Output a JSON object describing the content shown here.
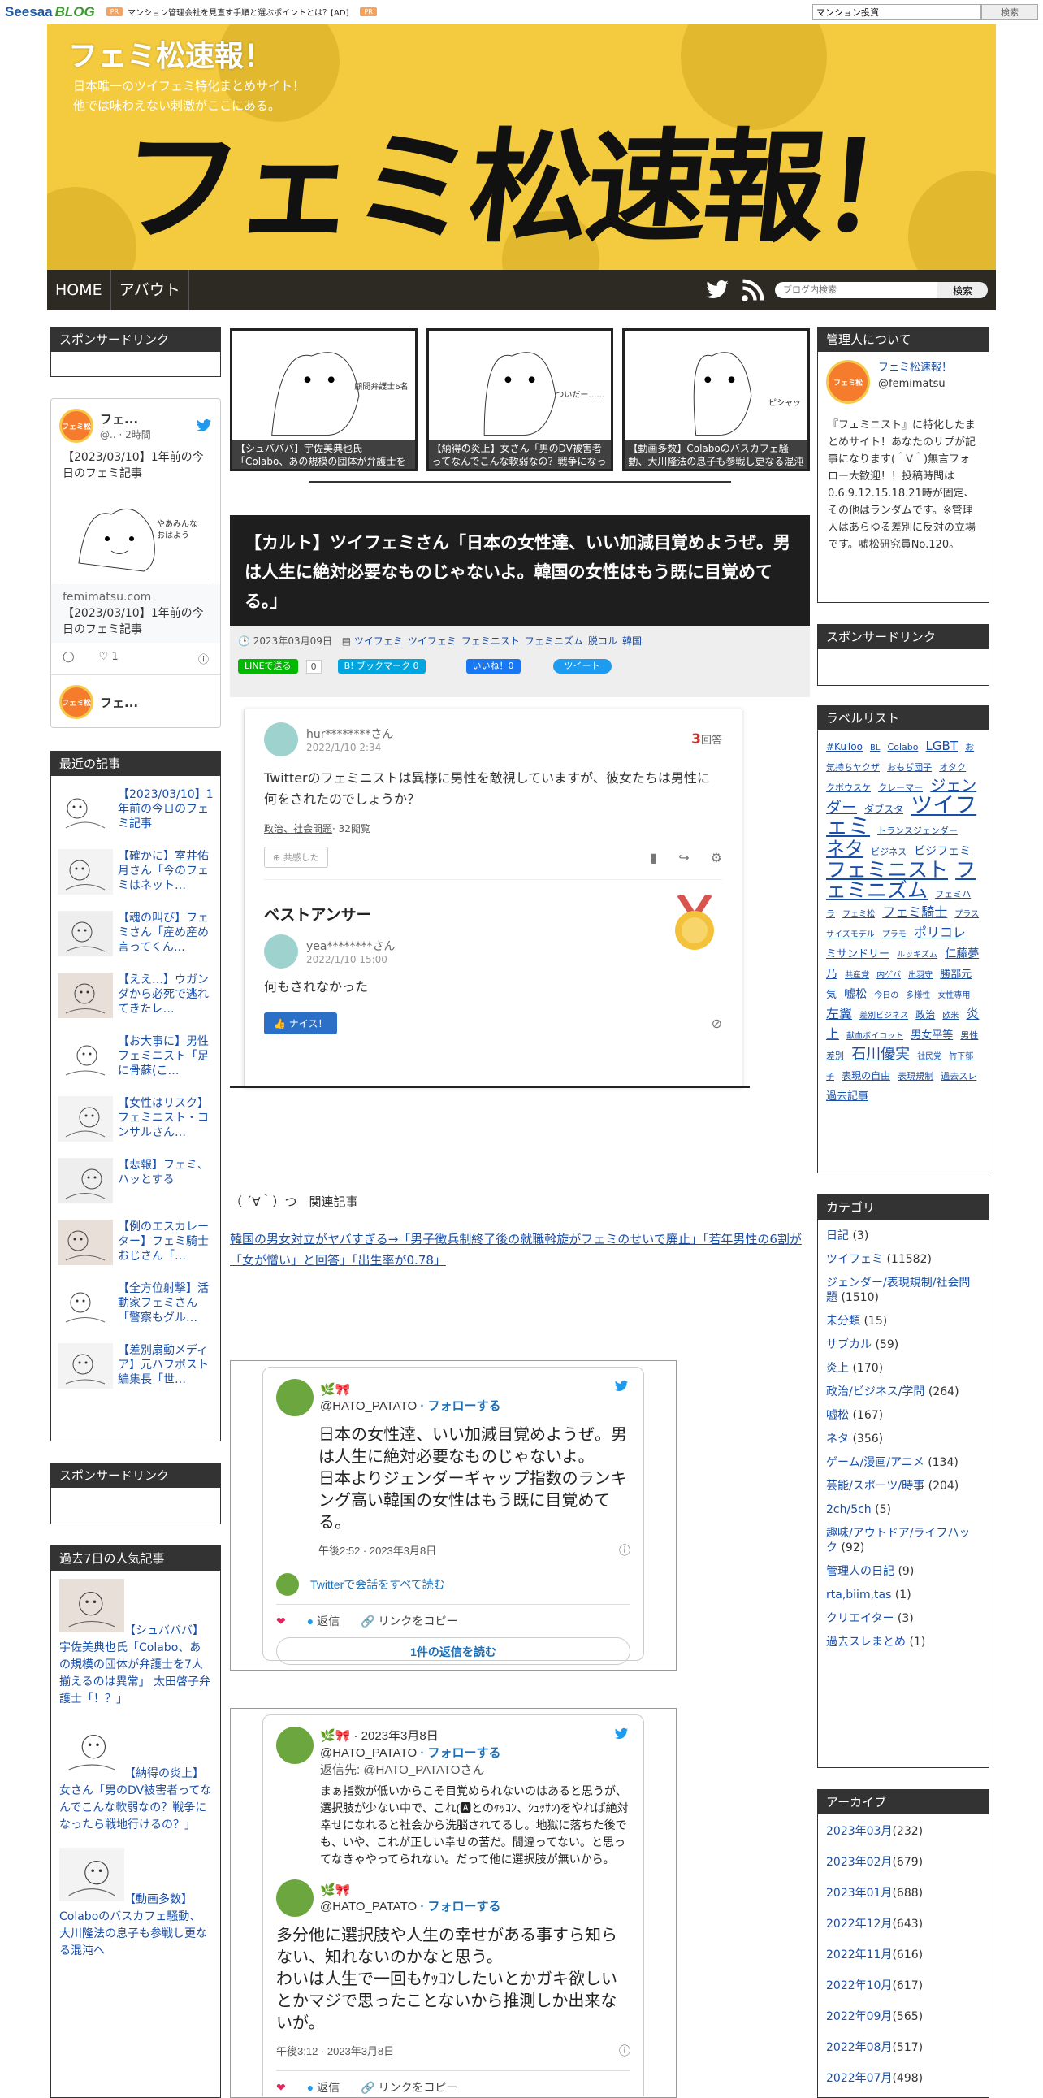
{
  "topbar": {
    "logo_main": "Seesaa",
    "logo_sub": "BLOG",
    "pr_badge": "PR",
    "ad_text": "マンション管理会社を見直す手順と選ぶポイントとは？[AD]",
    "pr_badge2": "PR",
    "search_value": "マンション投資",
    "search_button": "検索"
  },
  "header": {
    "site_title": "フェミ松速報！",
    "desc1": "日本唯一のツイフェミ特化まとめサイト！",
    "desc2": "他では味わえない刺激がここにある。",
    "logo_text": "フェミ松速報！"
  },
  "nav": {
    "home": "HOME",
    "about": "アバウト",
    "search_placeholder": "ブログ内検索",
    "search_button": "検索"
  },
  "left": {
    "sponsor_title": "スポンサードリンク",
    "twitter": {
      "name": "フェ...",
      "handle": "@..",
      "time": "· 2時間",
      "text": "【2023/03/10】1年前の今日のフェミ記事",
      "img_text": "やあみんな おはよう",
      "card_domain": "femimatsu.com",
      "card_title": "【2023/03/10】1年前の今日のフェミ記事",
      "likes": "1",
      "name2": "フェ..."
    },
    "recent_title": "最近の記事",
    "recent": [
      "【2023/03/10】1年前の今日のフェミ記事",
      "【確かに】室井佑月さん「今のフェミはネット…",
      "【魂の叫び】フェミさん「産め産め言ってくん…",
      "【ええ…】ウガンダから必死で逃れてきたレ…",
      "【お大事に】男性フェミニスト「足に骨蘇(こ…",
      "【女性はリスク】フェミニスト・コンサルさん…",
      "【悲報】フェミ、ハッとする",
      "【例のエスカレーター】フェミ騎士おじさん「…",
      "【全方位射撃】活動家フェミさん「警察もグル…",
      "【差別扇動メディア】元ハフポスト編集長「世…"
    ],
    "sponsor2_title": "スポンサードリンク",
    "popular_title": "過去7日の人気記事",
    "popular": [
      "【シュバババ】宇佐美典也氏「Colabo、あの規模の団体が弁護士を7人揃えるのは異常」 太田啓子弁護士「！？」",
      "【納得の炎上】女さん「男のDV被害者ってなんでこんな軟弱なの？戦争になったら戦地行けるの？」",
      "【動画多数】Colaboのバスカフェ騒動、大川隆法の息子も参戦し更なる混沌へ"
    ]
  },
  "feature": [
    {
      "caption": "【シュバババ】宇佐美典也氏「Colabo、あの規模の団体が弁護士を7人揃える",
      "img_text": "顧問弁護士6名"
    },
    {
      "caption": "【納得の炎上】女さん「男のDV被害者ってなんでこんな軟弱なの？戦争になった",
      "img_text": "ついだー……"
    },
    {
      "caption": "【動画多数】Colaboのバスカフェ騒動、大川隆法の息子も参戦し更なる混沌へ",
      "img_text": "ピシャッ"
    }
  ],
  "article": {
    "title": "【カルト】ツイフェミさん「日本の女性達、いい加減目覚めようぜ。男は人生に絶対必要なものじゃないよ。韓国の女性はもう既に目覚めてる。」",
    "date": "2023年03月09日",
    "categories": [
      "ツイフェミ",
      "ツイフェミ",
      "フェミニスト",
      "フェミニズム",
      "脱コル",
      "韓国"
    ],
    "line_btn": "LINEで送る",
    "line_count": "0",
    "hatena_btn": "B! ブックマーク",
    "hatena_count": "0",
    "fb_btn": "いいね！0",
    "tweet_btn": "ツイート"
  },
  "qa": {
    "user": "hur********さん",
    "answers_num": "3",
    "answers_label": "回答",
    "date": "2022/1/10 2:34",
    "question": "Twitterのフェミニストは異様に男性を敵視していますが、彼女たちは男性に何をされたのでしょうか？",
    "tag": "政治、社会問題",
    "views": "· 32閲覧",
    "share_btn": "共感した",
    "best_answer": "ベストアンサー",
    "ans_user": "yea********さん",
    "ans_date": "2022/1/10 15:00",
    "answer": "何もされなかった",
    "nice_btn": "ナイス！"
  },
  "related": {
    "heading": "（ ´∀｀）つ　関連記事",
    "links": "韓国の男女対立がヤバすぎる→「男子徴兵制終了後の就職斡旋がフェミのせいで廃止」「若年男性の6割が「女が憎い」と回答」「出生率が0.78」"
  },
  "tweet1": {
    "name": "🌿🎀",
    "handle": "@HATO_PATATO",
    "follow": "· フォローする",
    "text": "日本の女性達、いい加減目覚めようぜ。男は人生に絶対必要なものじゃないよ。\n日本よりジェンダーギャップ指数のランキング高い韓国の女性はもう既に目覚めてる。",
    "time": "午後2:52 · 2023年3月8日",
    "thread": "Twitterで会話をすべて読む",
    "reply": "返信",
    "copy": "リンクをコピー",
    "readall": "1件の返信を読む"
  },
  "tweet2": {
    "name": "🌿🎀 · 2023年3月8日",
    "handle": "@HATO_PATATO",
    "follow": "· フォローする",
    "replyto": "返信先: @HATO_PATATOさん",
    "text": "まぁ指数が低いからこそ目覚められないのはあると思うが、選択肢が少ない中で、これ(🅰とのｹｯｺﾝ、ｼｭｯｻﾝ)をやれば絶対幸せになれると社会から洗脳されてるし。地獄に落ちた後でも、いや、これが正しい幸せの苦だ。間違ってない。と思ってなきゃやってられない。だって他に選択肢が無いから。",
    "name2": "🌿🎀",
    "handle2": "@HATO_PATATO",
    "follow2": "· フォローする",
    "text2": "多分他に選択肢や人生の幸せがある事すら知らない、知れないのかなと思う。\nわいは人生で一回もｹｯｺﾝしたいとかガキ欲しいとかマジで思ったことないから推測しか出来ないが。",
    "time2": "午後3:12 · 2023年3月8日",
    "reply": "返信",
    "copy": "リンクをコピー"
  },
  "right": {
    "admin_title": "管理人について",
    "admin_name": "フェミ松速報！",
    "admin_handle": "@femimatsu",
    "admin_desc": "『フェミニスト』に特化したまとめサイト！あなたのリプが記事になります(＾∀＾)無言フォロー大歓迎！！投稿時間は0.6.9.12.15.18.21時が固定、その他はランダムです。※管理人はあらゆる差別に反対の立場です。嘘松研究員No.120。",
    "sponsor_title": "スポンサードリンク",
    "labels_title": "ラベルリスト",
    "labels": [
      {
        "t": "#KuToo",
        "s": 12
      },
      {
        "t": "BL",
        "s": 10
      },
      {
        "t": "Colabo",
        "s": 11
      },
      {
        "t": "LGBT",
        "s": 15
      },
      {
        "t": "お気持ちヤクザ",
        "s": 11
      },
      {
        "t": "おもぢ団子",
        "s": 11
      },
      {
        "t": "オタク",
        "s": 11
      },
      {
        "t": "クボウスケ",
        "s": 11
      },
      {
        "t": "クレーマー",
        "s": 11
      },
      {
        "t": "ジェンダー",
        "s": 19
      },
      {
        "t": "ダブスタ",
        "s": 12
      },
      {
        "t": "ツイフェミ",
        "s": 27
      },
      {
        "t": "トランスジェンダー",
        "s": 11
      },
      {
        "t": "ネタ",
        "s": 23
      },
      {
        "t": "ビジネス",
        "s": 11
      },
      {
        "t": "ビジフェミ",
        "s": 14
      },
      {
        "t": "フェミニスト",
        "s": 25
      },
      {
        "t": "フェミニズム",
        "s": 25
      },
      {
        "t": "フェミハラ",
        "s": 11
      },
      {
        "t": "フェミ松",
        "s": 10
      },
      {
        "t": "フェミ騎士",
        "s": 16
      },
      {
        "t": "プラスサイズモデル",
        "s": 10
      },
      {
        "t": "プラモ",
        "s": 10
      },
      {
        "t": "ポリコレ",
        "s": 16
      },
      {
        "t": "ミサンドリー",
        "s": 13
      },
      {
        "t": "ルッキズム",
        "s": 10
      },
      {
        "t": "仁藤夢乃",
        "s": 14
      },
      {
        "t": "共産党",
        "s": 10
      },
      {
        "t": "内ゲバ",
        "s": 10
      },
      {
        "t": "出羽守",
        "s": 10
      },
      {
        "t": "勝部元気",
        "s": 13
      },
      {
        "t": "嘘松",
        "s": 14
      },
      {
        "t": "今日の",
        "s": 10
      },
      {
        "t": "多様性",
        "s": 10
      },
      {
        "t": "女性専用",
        "s": 10
      },
      {
        "t": "左翼",
        "s": 16
      },
      {
        "t": "差別ビジネス",
        "s": 10
      },
      {
        "t": "政治",
        "s": 12
      },
      {
        "t": "欧米",
        "s": 10
      },
      {
        "t": "炎上",
        "s": 16
      },
      {
        "t": "献血ボイコット",
        "s": 10
      },
      {
        "t": "男女平等",
        "s": 13
      },
      {
        "t": "男性差別",
        "s": 11
      },
      {
        "t": "石川優実",
        "s": 18
      },
      {
        "t": "社民党",
        "s": 10
      },
      {
        "t": "竹下郁子",
        "s": 10
      },
      {
        "t": "表現の自由",
        "s": 12
      },
      {
        "t": "表現規制",
        "s": 11
      },
      {
        "t": "過去スレ",
        "s": 11
      },
      {
        "t": "過去記事",
        "s": 13
      }
    ],
    "categories_title": "カテゴリ",
    "categories": [
      {
        "name": "日記",
        "count": "(3)"
      },
      {
        "name": "ツイフェミ",
        "count": "(11582)"
      },
      {
        "name": "ジェンダー/表現規制/社会問題",
        "count": "(1510)"
      },
      {
        "name": "未分類",
        "count": "(15)"
      },
      {
        "name": "サブカル",
        "count": "(59)"
      },
      {
        "name": "炎上",
        "count": "(170)"
      },
      {
        "name": "政治/ビジネス/学問",
        "count": "(264)"
      },
      {
        "name": "嘘松",
        "count": "(167)"
      },
      {
        "name": "ネタ",
        "count": "(356)"
      },
      {
        "name": "ゲーム/漫画/アニメ",
        "count": "(134)"
      },
      {
        "name": "芸能/スポーツ/時事",
        "count": "(204)"
      },
      {
        "name": "2ch/5ch",
        "count": "(5)"
      },
      {
        "name": "趣味/アウトドア/ライフハック",
        "count": "(92)"
      },
      {
        "name": "管理人の日記",
        "count": "(9)"
      },
      {
        "name": "rta,biim,tas",
        "count": "(1)"
      },
      {
        "name": "クリエイター",
        "count": "(3)"
      },
      {
        "name": "過去スレまとめ",
        "count": "(1)"
      }
    ],
    "archive_title": "アーカイブ",
    "archive": [
      {
        "name": "2023年03月",
        "count": "(232)"
      },
      {
        "name": "2023年02月",
        "count": "(679)"
      },
      {
        "name": "2023年01月",
        "count": "(688)"
      },
      {
        "name": "2022年12月",
        "count": "(643)"
      },
      {
        "name": "2022年11月",
        "count": "(616)"
      },
      {
        "name": "2022年10月",
        "count": "(617)"
      },
      {
        "name": "2022年09月",
        "count": "(565)"
      },
      {
        "name": "2022年08月",
        "count": "(517)"
      },
      {
        "name": "2022年07月",
        "count": "(498)"
      }
    ]
  },
  "colors": {
    "header_yellow": "#f4cb3f",
    "nav_dark": "#2d2a24",
    "link_blue": "#1a4fa8",
    "twitter_blue": "#1d9bf0"
  }
}
